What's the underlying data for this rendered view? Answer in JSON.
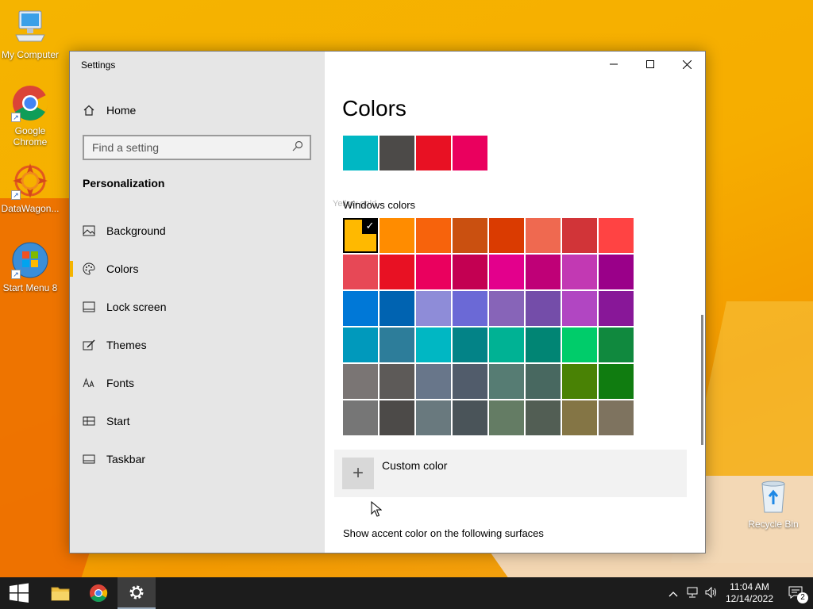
{
  "desktop": {
    "icons": [
      {
        "label": "My Computer"
      },
      {
        "label": "Google Chrome"
      },
      {
        "label": "DataWagon..."
      },
      {
        "label": "Start Menu 8"
      },
      {
        "label": "Recycle Bin"
      }
    ]
  },
  "window": {
    "title": "Settings",
    "home_label": "Home",
    "search_placeholder": "Find a setting",
    "section_label": "Personalization",
    "nav": [
      {
        "label": "Background",
        "icon": "picture-icon"
      },
      {
        "label": "Colors",
        "icon": "palette-icon",
        "active": true
      },
      {
        "label": "Lock screen",
        "icon": "lock-screen-icon"
      },
      {
        "label": "Themes",
        "icon": "themes-icon"
      },
      {
        "label": "Fonts",
        "icon": "fonts-icon"
      },
      {
        "label": "Start",
        "icon": "start-icon"
      },
      {
        "label": "Taskbar",
        "icon": "taskbar-icon"
      }
    ]
  },
  "content": {
    "page_title": "Colors",
    "ghost_text": "Yellow gold",
    "recent_colors": [
      "#00b7c3",
      "#4c4a48",
      "#e81123",
      "#ea005e"
    ],
    "windows_colors_label": "Windows colors",
    "windows_colors": [
      "#ffb900",
      "#ff8c00",
      "#f7630c",
      "#ca5010",
      "#da3b01",
      "#ef6950",
      "#d13438",
      "#ff4343",
      "#e74856",
      "#e81123",
      "#ea005e",
      "#c30052",
      "#e3008c",
      "#bf0077",
      "#c239b3",
      "#9a0089",
      "#0078d7",
      "#0063b1",
      "#8e8cd8",
      "#6b69d6",
      "#8764b8",
      "#744da9",
      "#b146c2",
      "#881798",
      "#0099bc",
      "#2d7d9a",
      "#00b7c3",
      "#038387",
      "#00b294",
      "#018574",
      "#00cc6a",
      "#10893e",
      "#7a7574",
      "#5d5a58",
      "#68768a",
      "#515c6b",
      "#567c73",
      "#486860",
      "#498205",
      "#107c10",
      "#767676",
      "#4c4a48",
      "#69797e",
      "#4a5459",
      "#647c64",
      "#525e54",
      "#847545",
      "#7e735f"
    ],
    "selected_index": 0,
    "custom_color_label": "Custom color",
    "surfaces_label": "Show accent color on the following surfaces"
  },
  "taskbar": {
    "clock_time": "11:04 AM",
    "clock_date": "12/14/2022",
    "notification_count": "2"
  }
}
